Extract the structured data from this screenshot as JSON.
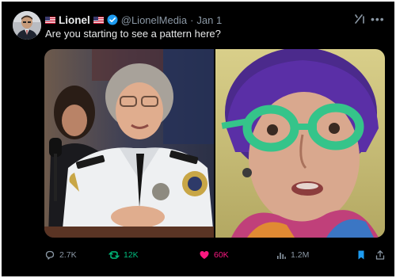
{
  "tweet": {
    "display_name": "Lionel",
    "handle": "@LionelMedia",
    "separator": "·",
    "date": "Jan 1",
    "text": "Are you starting to see a pattern here?",
    "icons": {
      "avatar": "user-avatar",
      "flag": "us-flag-icon",
      "verified": "verified-badge-icon",
      "grok": "grok-icon",
      "more": "more-options-icon"
    }
  },
  "media": {
    "photos": [
      {
        "name": "uniformed-officer-photo"
      },
      {
        "name": "green-glasses-woman-photo"
      }
    ]
  },
  "actions": {
    "replies": "2.7K",
    "reposts": "12K",
    "likes": "60K",
    "views": "1.2M",
    "icons": [
      "reply-icon",
      "repost-icon",
      "like-icon",
      "views-icon",
      "bookmark-icon",
      "share-icon"
    ]
  },
  "colors": {
    "background": "#000000",
    "text_primary": "#e7e9ea",
    "text_secondary": "#8b98a5",
    "verified": "#1d9bf0",
    "repost_active": "#00ba7c",
    "like_active": "#f91880",
    "bookmark_active": "#1d9bf0"
  }
}
